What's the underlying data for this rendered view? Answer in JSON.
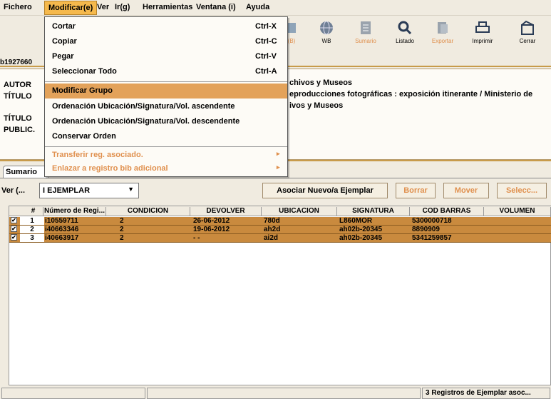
{
  "menubar": {
    "fichero": "Fichero",
    "modificar": "Modificar(e)",
    "ver": "Ver",
    "ir": "Ir(g)",
    "herramientas": "Herramientas",
    "ventana": "Ventana (i)",
    "ayuda": "Ayuda"
  },
  "toolbar": {
    "buttons": [
      {
        "label": "(B)",
        "icon": "unknown-icon",
        "disabled": true
      },
      {
        "label": "WB",
        "icon": "globe-icon",
        "disabled": false
      },
      {
        "label": "Sumario",
        "icon": "document-icon",
        "disabled": true
      },
      {
        "label": "Listado",
        "icon": "magnifier-icon",
        "disabled": false
      },
      {
        "label": "Exportar",
        "icon": "export-icon",
        "disabled": true
      },
      {
        "label": "Imprimir",
        "icon": "printer-icon",
        "disabled": false
      },
      {
        "label": "Cerrar",
        "icon": "close-door-icon",
        "disabled": false
      }
    ]
  },
  "record": {
    "id": "b1927660",
    "labels": [
      "AUTOR",
      "TÍTULO",
      "TÍTULO",
      "PUBLIC."
    ],
    "values": [
      "chivos y Museos",
      "eproducciones fotográficas : exposición itinerante / Ministerio de",
      "ivos y Museos"
    ]
  },
  "tabs": {
    "sumario": "Sumario"
  },
  "ver": {
    "label": "Ver (...",
    "selected": "I EJEMPLAR",
    "asociar": "Asociar Nuevo/a Ejemplar",
    "borrar": "Borrar",
    "mover": "Mover",
    "selecc": "Selecc..."
  },
  "table": {
    "headers": [
      "#",
      "Número de Regi...",
      "CONDICION",
      "DEVOLVER",
      "UBICACION",
      "SIGNATURA",
      "COD BARRAS",
      "VOLUMEN"
    ],
    "rows": [
      {
        "n": "1",
        "reg": "i10559711",
        "cond": "2",
        "devolver": "26-06-2012",
        "ubic": "780d",
        "sig": "L860MOR",
        "cod": "5300000718",
        "vol": ""
      },
      {
        "n": "2",
        "reg": "i40663346",
        "cond": "2",
        "devolver": "19-06-2012",
        "ubic": "ah2d",
        "sig": "ah02b-20345",
        "cod": "8890909",
        "vol": ""
      },
      {
        "n": "3",
        "reg": "i40663917",
        "cond": "2",
        "devolver": "- -",
        "ubic": "ai2d",
        "sig": "ah02b-20345",
        "cod": "5341259857",
        "vol": ""
      }
    ]
  },
  "status": {
    "text": "3 Registros de Ejemplar asoc..."
  },
  "menu": {
    "items": [
      {
        "label": "Cortar",
        "shortcut": "Ctrl-X"
      },
      {
        "label": "Copiar",
        "shortcut": "Ctrl-C"
      },
      {
        "label": "Pegar",
        "shortcut": "Ctrl-V"
      },
      {
        "label": "Seleccionar Todo",
        "shortcut": "Ctrl-A"
      },
      {
        "label": "Modificar Grupo",
        "shortcut": ""
      },
      {
        "label": "Ordenación Ubicación/Signatura/Vol. ascendente",
        "shortcut": ""
      },
      {
        "label": "Ordenación Ubicación/Signatura/Vol. descendente",
        "shortcut": ""
      },
      {
        "label": "Conservar Orden",
        "shortcut": ""
      },
      {
        "label": "Transferir reg. asociado.",
        "shortcut": ""
      },
      {
        "label": "Enlazar a registro bib adicional",
        "shortcut": ""
      }
    ]
  },
  "colors": {
    "accent": "#f5b94d",
    "row": "#c98a3e",
    "highlight": "#e3a25a",
    "disabled": "#e0904e"
  }
}
